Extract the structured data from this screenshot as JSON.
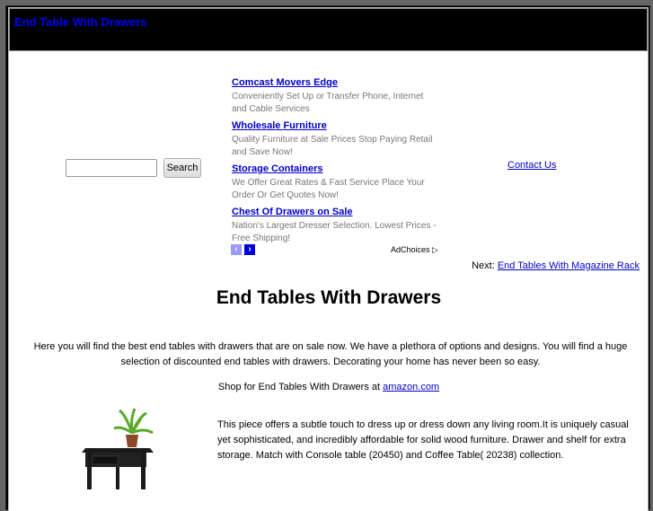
{
  "header": {
    "site_title": "End Table With Drawers"
  },
  "search": {
    "placeholder": "",
    "value": "",
    "button_label": "Search"
  },
  "ads": {
    "items": [
      {
        "title": "Comcast Movers Edge",
        "description": "Conveniently Set Up or Transfer Phone, Internet and Cable Services"
      },
      {
        "title": "Wholesale Furniture",
        "description": "Quality Furniture at Sale Prices Stop Paying Retail and Save Now!"
      },
      {
        "title": "Storage Containers",
        "description": "We Offer Great Rates & Fast Service Place Your Order Or Get Quotes Now!"
      },
      {
        "title": "Chest Of Drawers on Sale",
        "description": "Nation's Largest Dresser Selection. Lowest Prices - Free Shipping!"
      }
    ],
    "prev_icon": "‹",
    "next_icon": "›",
    "adchoices_label": "AdChoices",
    "adchoices_icon": "▷"
  },
  "nav": {
    "contact_label": "Contact Us",
    "next_prefix": "Next:",
    "next_link": "End Tables With Magazine Rack"
  },
  "main": {
    "title": "End Tables With Drawers",
    "intro": "Here you will find the best end tables with drawers that are on sale now. We have a plethora of options and designs. You will find a huge selection of discounted end tables with drawers. Decorating your home has never been so easy.",
    "shop_prefix": "Shop for End Tables With Drawers at",
    "shop_link": "amazon.com",
    "product_description": "This piece offers a subtle touch to dress up or dress down any living room.It is uniquely casual yet sophisticated, and incredibly affordable for solid wood furniture. Drawer and shelf for extra storage. Match with Console table (20450) and Coffee Table( 20238) collection."
  }
}
